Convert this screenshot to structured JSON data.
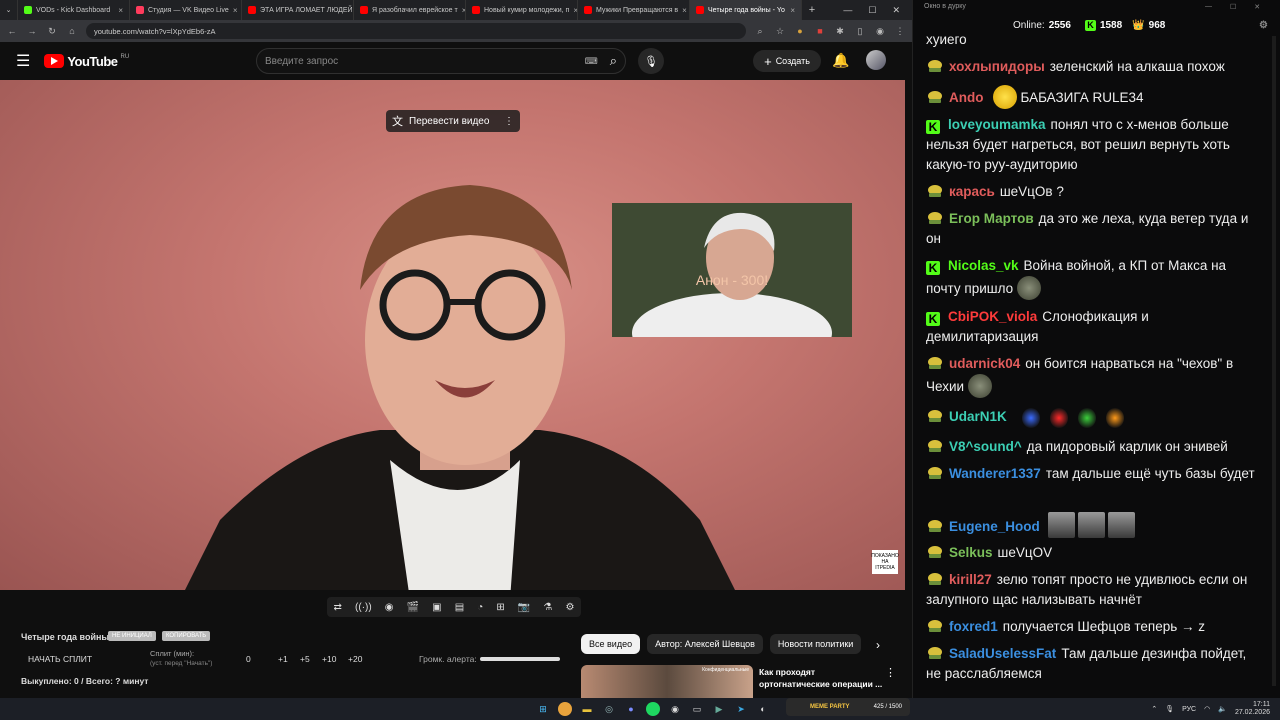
{
  "tabs": [
    {
      "label": "VODs - Kick Dashboard",
      "color": "#53fc18"
    },
    {
      "label": "Студия — VK Видео Live",
      "color": "#ff3b5c"
    },
    {
      "label": "ЭТА ИГРА ЛОМАЕТ ЛЮДЕЙ",
      "color": "#ff0000"
    },
    {
      "label": "Я разоблачил еврейское т",
      "color": "#ff0000"
    },
    {
      "label": "Новый кумир молодежи, п",
      "color": "#ff0000"
    },
    {
      "label": "Мужики Превращаются в ",
      "color": "#ff0000"
    },
    {
      "label": "Четыре года войны - Yo",
      "color": "#ff0000"
    }
  ],
  "address": {
    "url": "youtube.com/watch?v=lXpYdEb6-zA"
  },
  "youtube": {
    "logo": "YouTube",
    "region": "RU",
    "search_placeholder": "Введите запрос",
    "create_label": "Создать"
  },
  "video": {
    "translate_label": "Перевести видео",
    "inset_caption": "Анон - 300!",
    "watermark": "ПОКАЗАНО НА ITPEDIA"
  },
  "below": {
    "title": "Четыре года войны",
    "badge1": "НЕ ИНИЦИАЛ",
    "badge2": "КОПИРОВАТЬ",
    "start_split": "НАЧАТЬ СПЛИТ",
    "split_label": "Сплит (мин):",
    "split_hint": "(уст. перед \"Начать\")",
    "split_value": "0",
    "increments": [
      "+1",
      "+5",
      "+10",
      "+20"
    ],
    "alert_label": "Громк. алерта:",
    "bought": "Выкуплено: 0 / Всего: ? минут",
    "chips": [
      "Все видео",
      "Автор: Алексей Шевцов",
      "Новости политики"
    ],
    "rec_title": "Как проходят ортогнатические операции ...",
    "rec_thumb_label": "Конфиденциальные"
  },
  "chat": {
    "window_title": "Окно в дурку",
    "online_label": "Online:",
    "online_value": "2556",
    "kick_value": "1588",
    "vk_value": "968",
    "messages": [
      {
        "user": "",
        "text": "хуиего",
        "color": "#eee",
        "platform": "none"
      },
      {
        "user": "хохлыпидоры",
        "text": "зеленский на алкаша похож",
        "color": "#e05c5c",
        "platform": "vk"
      },
      {
        "user": "Ando",
        "text": "БАБАЗИГА RULE34",
        "color": "#e05c5c",
        "platform": "vk"
      },
      {
        "user": "loveyoumamka",
        "text": "понял что с х-менов больше нельзя будет нагреться, вот решил вернуть хоть какую-то руу-аудиторию",
        "color": "#3ccfb4",
        "platform": "kick"
      },
      {
        "user": "карась",
        "text": "шеVцОв ?",
        "color": "#e05c5c",
        "platform": "vk"
      },
      {
        "user": "Егор Мартов",
        "text": "да это же леха, куда ветер туда и он",
        "color": "#7bbf5a",
        "platform": "vk"
      },
      {
        "user": "Nicolas_vk",
        "text": "Война войной, а КП от Макса на почту пришло",
        "color": "#53fc18",
        "platform": "kick"
      },
      {
        "user": "CbiPOK_viola",
        "text": "Слонофикация и демилитаризация",
        "color": "#ff3b3b",
        "platform": "kick"
      },
      {
        "user": "udarnick04",
        "text": "он боится нарваться на \"чехов\" в Чехии",
        "color": "#e05c5c",
        "platform": "vk"
      },
      {
        "user": "UdarN1K",
        "text": "",
        "color": "#3ccfb4",
        "platform": "vk"
      },
      {
        "user": "V8^sound^",
        "text": "да пидоровый карлик он энивей",
        "color": "#3ccfb4",
        "platform": "vk"
      },
      {
        "user": "Wanderer1337",
        "text": "там дальше ещё чуть базы будет",
        "color": "#3b8fe0",
        "platform": "vk"
      },
      {
        "user": "Eugene_Hood",
        "text": "",
        "color": "#3b8fe0",
        "platform": "vk"
      },
      {
        "user": "Selkus",
        "text": "шеVцОV",
        "color": "#7bbf5a",
        "platform": "vk"
      },
      {
        "user": "kirill27",
        "text": "зелю топят просто не удивлюсь если он залупного щас нализывать начнёт",
        "color": "#e05c5c",
        "platform": "vk"
      },
      {
        "user": "foxred1",
        "text": "получается Шефцов теперь → z",
        "color": "#3b8fe0",
        "platform": "vk"
      },
      {
        "user": "SaladUselessFat",
        "text": "Там дальше дезинфа пойдет, не расслабляемся",
        "color": "#3b8fe0",
        "platform": "vk"
      }
    ]
  },
  "taskbar": {
    "lang": "РУС",
    "time": "17:11",
    "date": "27.02.2026",
    "overlay_label": "MEME PARTY",
    "overlay_progress": "425 / 1500"
  }
}
